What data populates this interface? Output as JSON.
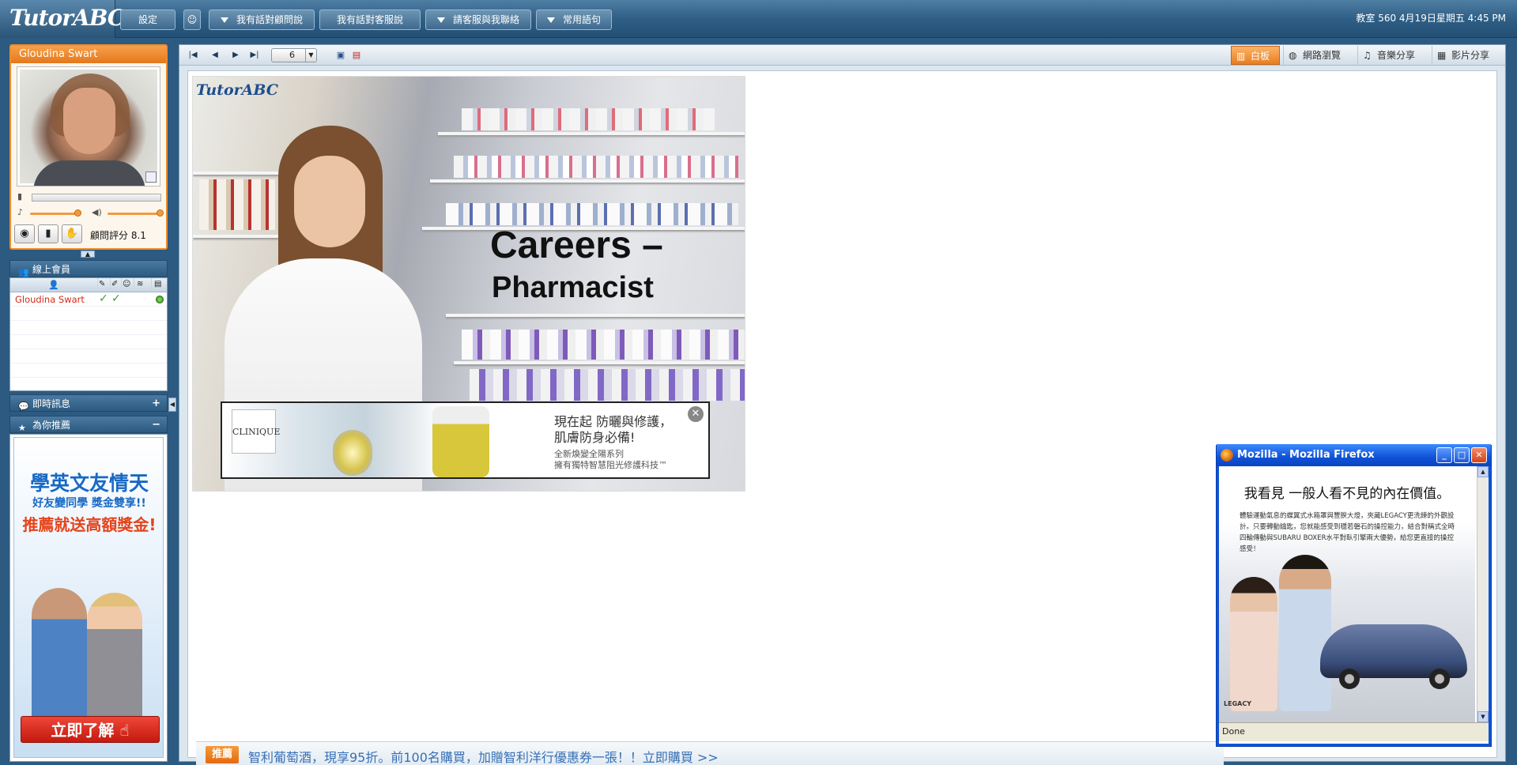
{
  "topbar": {
    "logo": "TutorABC",
    "buttons": {
      "settings": "設定",
      "talk_consultant": "我有話對顧問說",
      "talk_service": "我有話對客服說",
      "contact_me": "請客服與我聯絡",
      "phrases": "常用語句"
    },
    "status": "教室 560 4月19日星期五 4:45 PM"
  },
  "teacher": {
    "name": "Gloudina Swart",
    "rating_label": "顧問評分",
    "rating_value": "8.1"
  },
  "members": {
    "title": "線上會員",
    "rows": [
      {
        "name": "Gloudina Swart",
        "mic_ok": "✓",
        "pen_ok": "✓"
      }
    ]
  },
  "instant_message": {
    "title": "即時訊息",
    "action": "+"
  },
  "recommend": {
    "title": "為你推薦",
    "action": "−",
    "ad_line1": "學英文友情天",
    "ad_line2": "好友變同學 獎金雙享!!",
    "ad_line3": "推薦就送高額獎金!",
    "ad_button": "立即了解"
  },
  "toolbar": {
    "page_value": "6",
    "tabs": {
      "whiteboard": "白板",
      "web_browse": "網路瀏覽",
      "music_share": "音樂分享",
      "video_share": "影片分享"
    }
  },
  "slide": {
    "logo": "TutorABC",
    "title_line1": "Careers –",
    "title_line2": "Pharmacist"
  },
  "clinique_ad": {
    "logo": "CLINIQUE",
    "text_line1": "現在起 防曬與修護，",
    "text_line2": "肌膚防身必備!",
    "sub_line1": "全新煥變全陽系列",
    "sub_line2": "擁有獨特智慧阻光修護科技™"
  },
  "promo": {
    "tag": "推薦",
    "text": "智利葡萄酒，現享95折。前100名購買，加贈智利洋行優惠券一張！！立即購買 >>"
  },
  "firefox": {
    "title": "Mozilla - Mozilla Firefox",
    "heading": "我看見 一般人看不見的內在價值。",
    "body": "體驗運動氣息的蝶翼式水箱罩與豐腴大燈，夾藏LEGACY更洗鍊的外觀設計。只要轉動鑰匙，您就能感受到穩若磐石的操控能力，結合對稱式全時四輪傳動與SUBARU BOXER水平對臥引擎兩大優勢，給您更直接的操控感受！",
    "brand": "LEGACY",
    "status": "Done"
  },
  "colors": {
    "accent_orange": "#ef8c2b",
    "nav_blue": "#2f5f86",
    "promo_blue": "#3770b6",
    "member_red": "#d2291a"
  }
}
